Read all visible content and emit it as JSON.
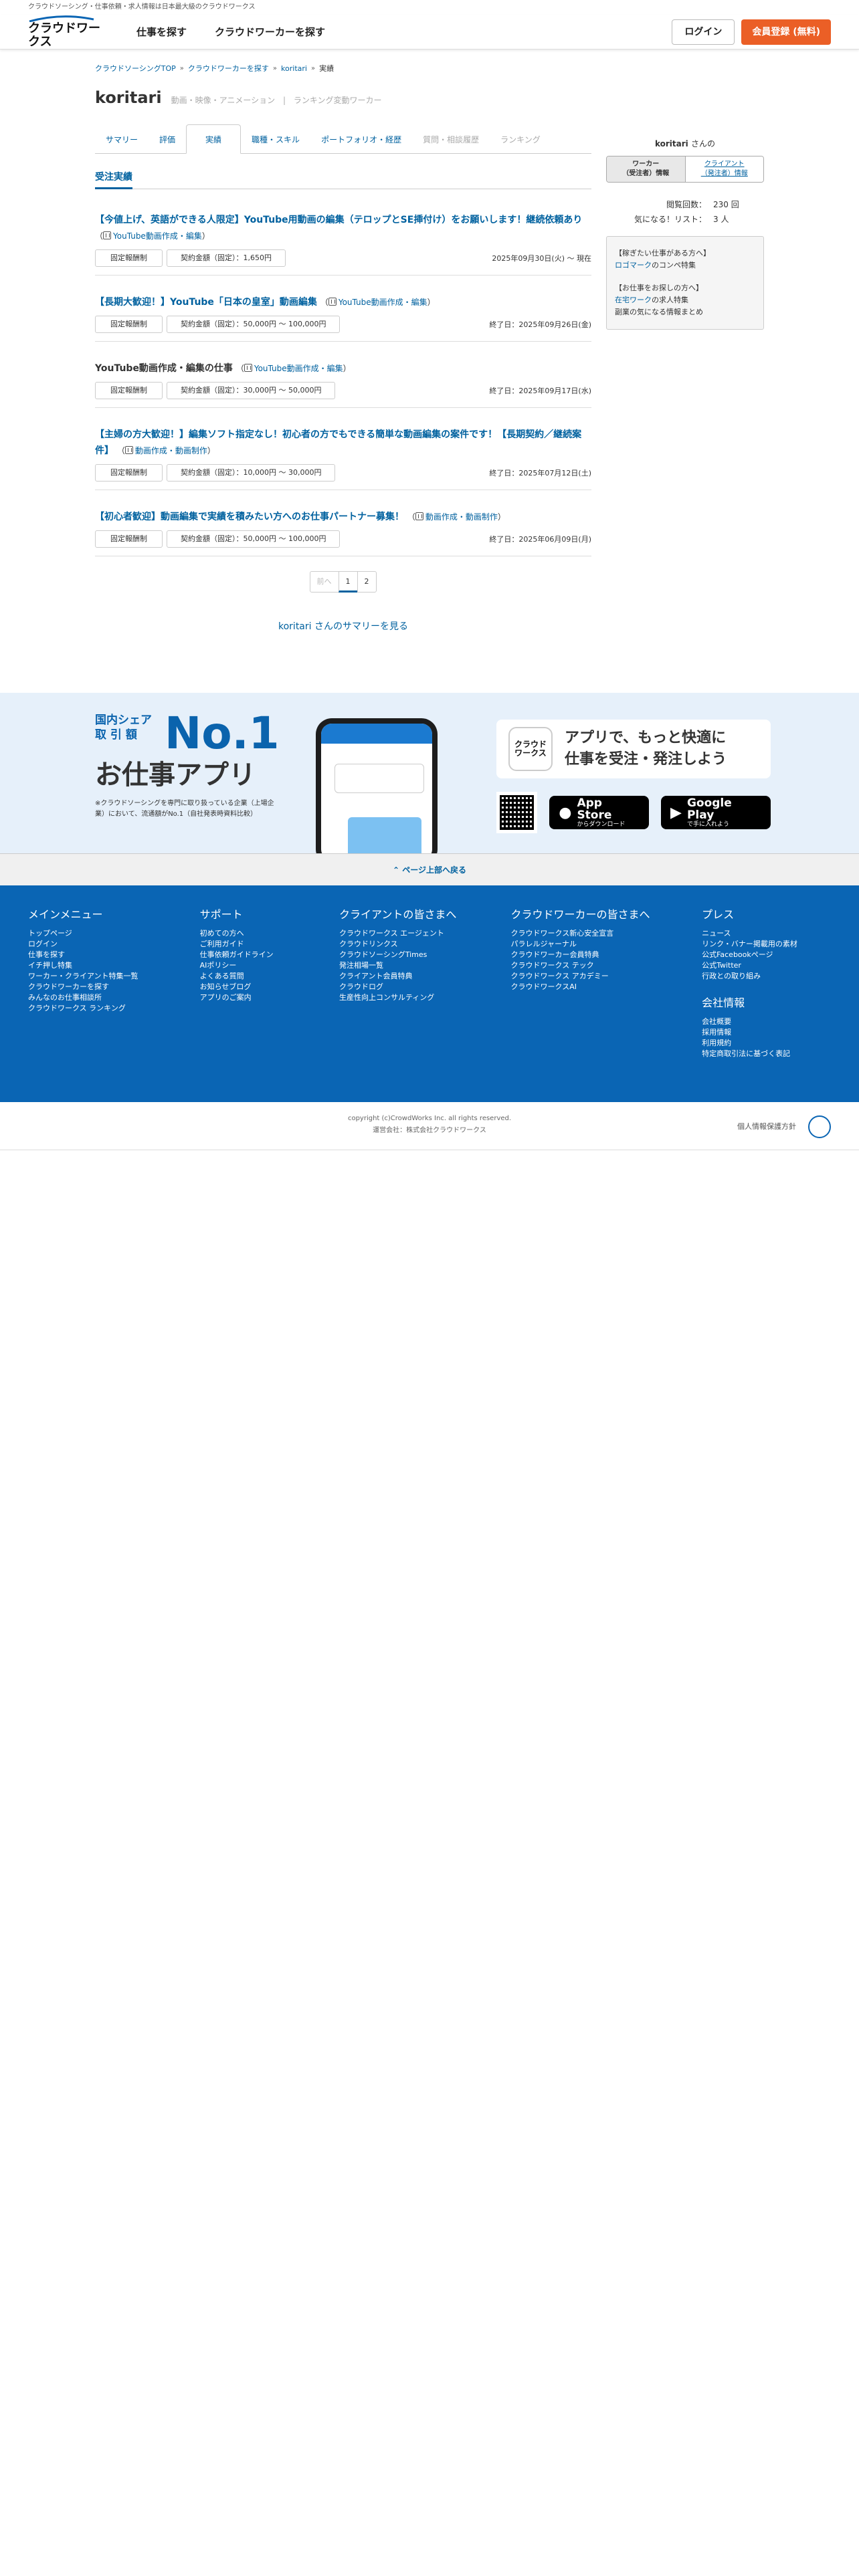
{
  "top_strip": "クラウドソーシング・仕事依頼・求人情報は日本最大級のクラウドワークス",
  "header": {
    "logo_text": "クラウドワークス",
    "nav": [
      "仕事を探す",
      "クラウドワーカーを探す"
    ],
    "login": "ログイン",
    "signup": "会員登録 (無料)"
  },
  "breadcrumb": [
    "クラウドソーシングTOP",
    "クラウドワーカーを探す",
    "koritari",
    "実績"
  ],
  "profile": {
    "name": "koritari",
    "category": "動画・映像・アニメーション",
    "rank": "ランキング変動ワーカー"
  },
  "tabs": [
    {
      "label": "サマリー",
      "state": "link"
    },
    {
      "label": "評価",
      "state": "link"
    },
    {
      "label": "実績",
      "state": "active"
    },
    {
      "label": "職種・スキル",
      "state": "link"
    },
    {
      "label": "ポートフォリオ・経歴",
      "state": "link"
    },
    {
      "label": "質問・相談履歴",
      "state": "disabled"
    },
    {
      "label": "ランキング",
      "state": "disabled"
    }
  ],
  "section_title": "受注実績",
  "jobs": [
    {
      "title": "【今値上げ、英語ができる人限定】YouTube用動画の編集（テロップとSE挿付け）をお願いします！継続依頼あり",
      "title_link": true,
      "category": "YouTube動画作成・編集",
      "type": "固定報酬制",
      "amount": "契約金額（固定）：1,650円",
      "date": "2025年09月30日(火) 〜 現在"
    },
    {
      "title": "【長期大歓迎！】YouTube「日本の皇室」動画編集",
      "title_link": true,
      "category": "YouTube動画作成・編集",
      "type": "固定報酬制",
      "amount": "契約金額（固定）：50,000円 〜 100,000円",
      "date": "終了日：2025年09月26日(金)"
    },
    {
      "title": "YouTube動画作成・編集の仕事",
      "title_link": false,
      "category": "YouTube動画作成・編集",
      "type": "固定報酬制",
      "amount": "契約金額（固定）：30,000円 〜 50,000円",
      "date": "終了日：2025年09月17日(水)"
    },
    {
      "title": "【主婦の方大歓迎！】編集ソフト指定なし！初心者の方でもできる簡単な動画編集の案件です！【長期契約／継続案件】",
      "title_link": true,
      "category": "動画作成・動画制作",
      "type": "固定報酬制",
      "amount": "契約金額（固定）：10,000円 〜 30,000円",
      "date": "終了日：2025年07月12日(土)"
    },
    {
      "title": "【初心者歓迎】動画編集で実績を積みたい方へのお仕事パートナー募集！",
      "title_link": true,
      "category": "動画作成・動画制作",
      "type": "固定報酬制",
      "amount": "契約金額（固定）：50,000円 〜 100,000円",
      "date": "終了日：2025年06月09日(月)"
    }
  ],
  "pager": {
    "prev": "前へ",
    "current": "1",
    "next": "2"
  },
  "summary_link": "koritari さんのサマリーを見る",
  "sidebar": {
    "name": "koritari",
    "san": "さんの",
    "toggle_on": [
      "ワーカー",
      "（受注者）情報"
    ],
    "toggle_off": [
      "クライアント",
      "（発注者）情報"
    ],
    "stats": [
      {
        "label": "閲覧回数：",
        "value": "230 回"
      },
      {
        "label": "気になる！リスト：",
        "value": "3 人"
      }
    ],
    "box": [
      {
        "head": "【稼ぎたい仕事がある方へ】",
        "link": "ロゴマーク",
        "tail": "のコンペ特集"
      },
      {
        "head": "【お仕事をお探しの方へ】",
        "link": "在宅ワーク",
        "tail": "の求人特集"
      },
      {
        "head": "",
        "link": "",
        "tail": "副業の気になる情報まとめ"
      }
    ]
  },
  "app_banner": {
    "share_line1": "国内シェア",
    "share_line2": "取 引 額",
    "no1": "No.1",
    "app_title": "お仕事アプリ",
    "note": "※クラウドソーシングを専門に取り扱っている企業（上場企業）において、流通額がNo.1（自社発表時資料比較）",
    "app_icon": "クラウド ワークス",
    "catch_line1": "アプリで、もっと快適に",
    "catch_line2": "仕事を受注・発注しよう",
    "appstore_small": "App Store",
    "appstore_sub": "からダウンロード",
    "googleplay_small": "Google Play",
    "googleplay_sub": "で手に入れよう"
  },
  "backtop": "ページ上部へ戻る",
  "footer": {
    "cols": [
      {
        "title": "メインメニュー",
        "items": [
          "トップページ",
          "ログイン",
          "仕事を探す",
          "イチ押し特集",
          "ワーカー・クライアント特集一覧",
          "クラウドワーカーを探す",
          "みんなのお仕事相談所",
          "クラウドワークス ランキング"
        ]
      },
      {
        "title": "サポート",
        "items": [
          "初めての方へ",
          "ご利用ガイド",
          "仕事依頼ガイドライン",
          "AIポリシー",
          "よくある質問",
          "お知らせブログ",
          "アプリのご案内"
        ]
      },
      {
        "title": "クライアントの皆さまへ",
        "items": [
          "クラウドワークス エージェント",
          "クラウドリンクス",
          "クラウドソーシングTimes",
          "発注相場一覧",
          "クライアント会員特典",
          "クラウドログ",
          "生産性向上コンサルティング"
        ]
      },
      {
        "title": "クラウドワーカーの皆さまへ",
        "items": [
          "クラウドワークス新心安全宣言",
          "パラレルジャーナル",
          "クラウドワーカー会員特典",
          "クラウドワークス テック",
          "クラウドワークス アカデミー",
          "クラウドワークスAI"
        ]
      },
      {
        "title": "プレス",
        "items": [
          "ニュース",
          "リンク・バナー掲載用の素材",
          "公式Facebookページ",
          "公式Twitter",
          "行政との取り組み"
        ],
        "title2": "会社情報",
        "items2": [
          "会社概要",
          "採用情報",
          "利用規約",
          "特定商取引法に基づく表記"
        ]
      }
    ],
    "copyright": "copyright (c)CrowdWorks Inc. all rights reserved.",
    "operator": "運営会社：株式会社クラウドワークス",
    "privacy": "個人情報保護方針"
  }
}
